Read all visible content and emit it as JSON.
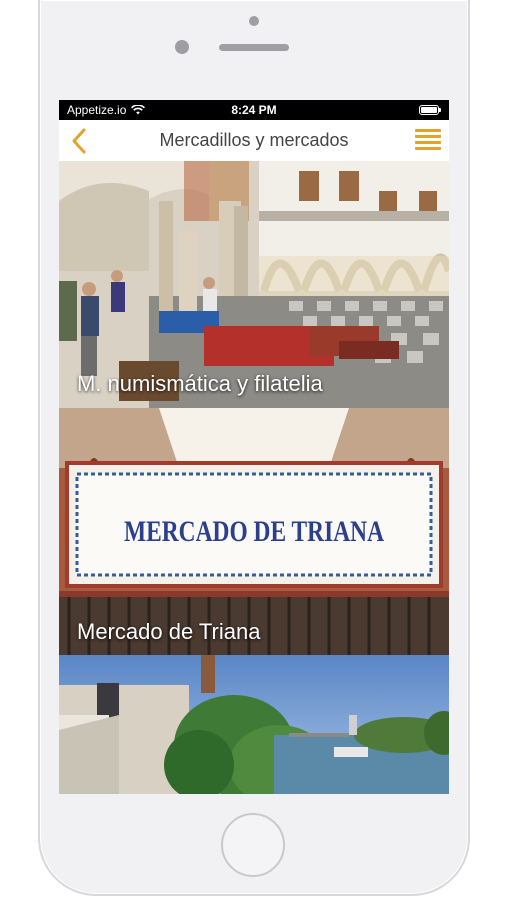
{
  "status_bar": {
    "carrier": "Appetize.io",
    "time": "8:24 PM"
  },
  "nav": {
    "title": "Mercadillos y mercados",
    "back_icon": "chevron-left-icon",
    "menu_icon": "hamburger-menu-icon",
    "accent_color": "#e3a32a"
  },
  "cards": [
    {
      "label": "M. numismática y filatelia"
    },
    {
      "label": "Mercado de Triana",
      "sign_text": "MERCADO DE TRIANA"
    },
    {
      "label": ""
    }
  ]
}
